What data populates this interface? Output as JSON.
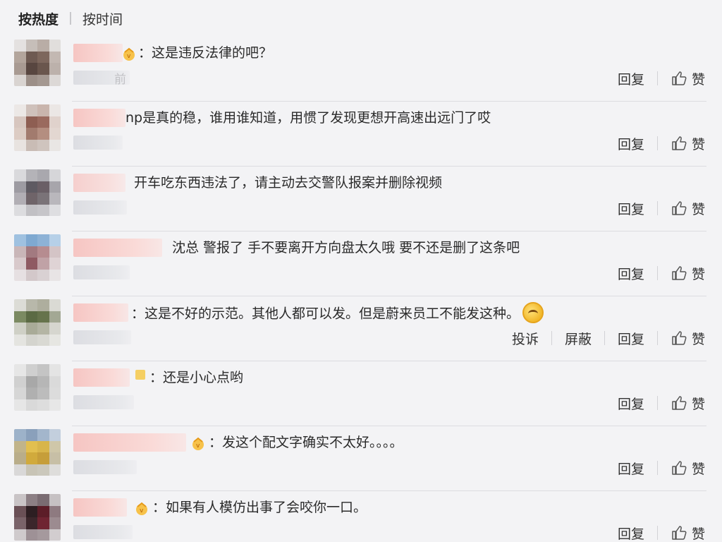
{
  "sort": {
    "hot_label": "按热度",
    "time_label": "按时间"
  },
  "actions": {
    "reply": "回复",
    "like": "赞",
    "report": "投诉",
    "block": "屏蔽"
  },
  "comments": [
    {
      "text": "：这是违反法律的吧？",
      "meta_suffix": "前",
      "has_report": false
    },
    {
      "text": "np是真的稳，谁用谁知道，用惯了发现更想开高速出远门了哎",
      "meta_suffix": "",
      "has_report": false
    },
    {
      "text": "开车吃东西违法了，请主动去交警队报案并删除视频",
      "meta_suffix": "",
      "has_report": false
    },
    {
      "text": "沈总 警报了 手不要离开方向盘太久哦 要不还是删了这条吧",
      "meta_suffix": "",
      "has_report": false
    },
    {
      "text": "：这是不好的示范。其他人都可以发。但是蔚来员工不能发这种。",
      "meta_suffix": "",
      "has_report": true
    },
    {
      "text": "：还是小心点哟",
      "meta_suffix": "",
      "has_report": false
    },
    {
      "text": "：发这个配文字确实不太好。。。。",
      "meta_suffix": "",
      "has_report": false
    },
    {
      "text": "：如果有人模仿出事了会咬你一口。",
      "meta_suffix": "",
      "has_report": false
    }
  ]
}
